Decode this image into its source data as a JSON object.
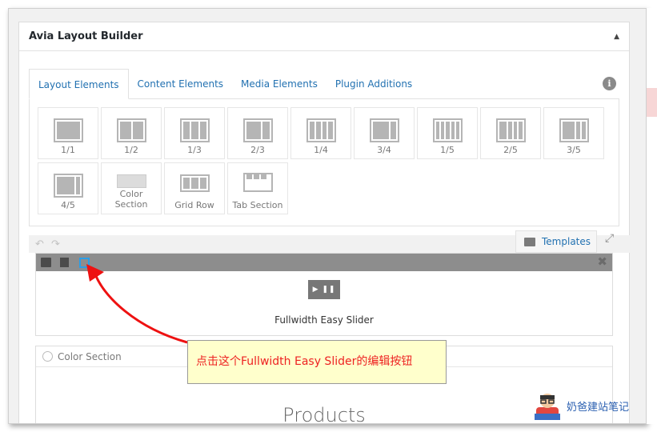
{
  "builder": {
    "title": "Avia Layout Builder",
    "collapse_glyph": "▲"
  },
  "tabs": [
    {
      "label": "Layout Elements",
      "active": true
    },
    {
      "label": "Content Elements",
      "active": false
    },
    {
      "label": "Media Elements",
      "active": false
    },
    {
      "label": "Plugin Additions",
      "active": false
    }
  ],
  "info_glyph": "i",
  "elements": [
    {
      "label": "1/1"
    },
    {
      "label": "1/2"
    },
    {
      "label": "1/3"
    },
    {
      "label": "2/3"
    },
    {
      "label": "1/4"
    },
    {
      "label": "3/4"
    },
    {
      "label": "1/5"
    },
    {
      "label": "2/5"
    },
    {
      "label": "3/5"
    },
    {
      "label": "4/5"
    },
    {
      "label": "Color Section"
    },
    {
      "label": "Grid Row"
    },
    {
      "label": "Tab Section"
    }
  ],
  "toolbar": {
    "undo_glyph": "↶",
    "redo_glyph": "↷",
    "templates_label": "Templates",
    "expand_glyph": "⤢",
    "close_glyph": "✖"
  },
  "canvas": {
    "slider_play_glyph": "▶ ❚❚",
    "slider_label": "Fullwidth Easy Slider",
    "color_section_label": "Color Section",
    "products_heading": "Products"
  },
  "annotation": {
    "callout_text": "点击这个Fullwidth Easy Slider的编辑按钮",
    "callout_color": "#ee2222",
    "arrow_color": "#ee1111"
  },
  "watermark": {
    "text": "奶爸建站笔记"
  },
  "colors": {
    "link_blue": "#2271b1",
    "edit_icon_blue": "#2a9ee8",
    "bar_gray": "#8d8d8d"
  }
}
